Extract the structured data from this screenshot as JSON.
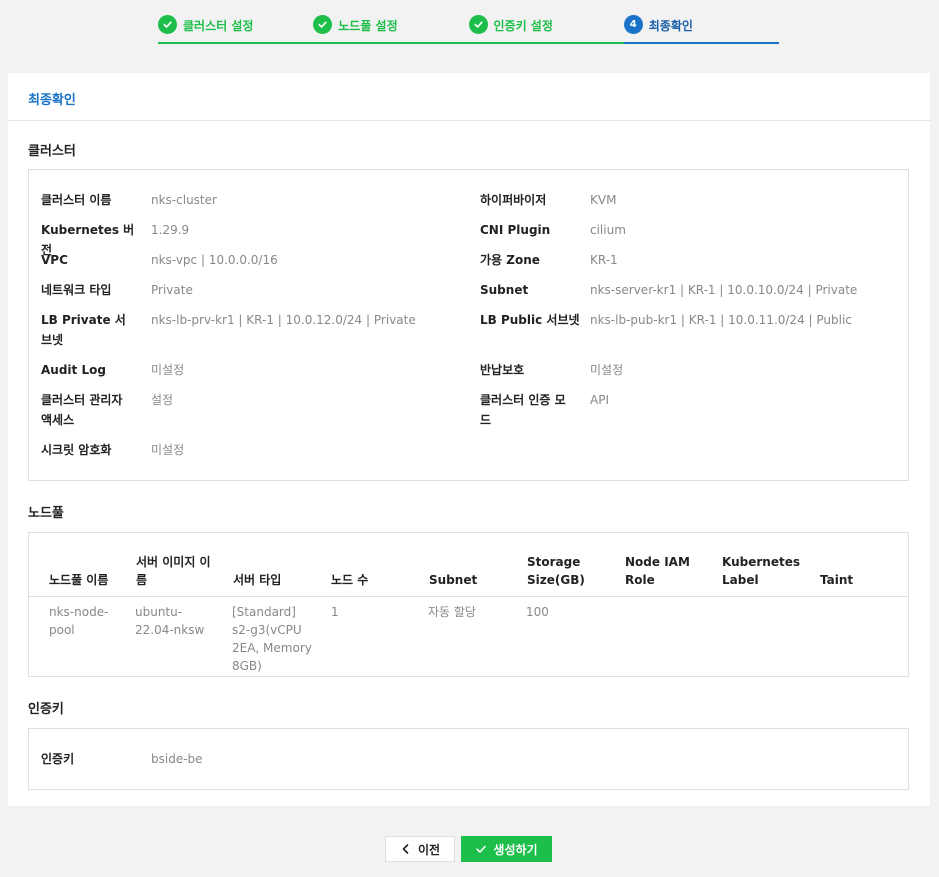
{
  "stepper": {
    "steps": [
      {
        "label": "클러스터 설정",
        "state": "done"
      },
      {
        "label": "노드풀 설정",
        "state": "done"
      },
      {
        "label": "인증키 설정",
        "state": "done"
      },
      {
        "label": "최종확인",
        "number": "4",
        "state": "active"
      }
    ]
  },
  "card": {
    "title": "최종확인"
  },
  "cluster": {
    "title": "클러스터",
    "left": [
      {
        "key": "클러스터 이름",
        "value": "nks-cluster"
      },
      {
        "key": "Kubernetes 버전",
        "value": "1.29.9"
      },
      {
        "key": "VPC",
        "value": "nks-vpc | 10.0.0.0/16"
      },
      {
        "key": "네트워크 타입",
        "value": "Private"
      },
      {
        "key": "LB Private 서브넷",
        "value": "nks-lb-prv-kr1 | KR-1 | 10.0.12.0/24 | Private"
      },
      {
        "key": "Audit Log",
        "value": "미설정"
      },
      {
        "key": "클러스터 관리자 액세스",
        "value": "설정"
      },
      {
        "key": "시크릿 암호화",
        "value": "미설정"
      }
    ],
    "right": [
      {
        "key": "하이퍼바이저",
        "value": "KVM"
      },
      {
        "key": "CNI Plugin",
        "value": "cilium"
      },
      {
        "key": "가용 Zone",
        "value": "KR-1"
      },
      {
        "key": "Subnet",
        "value": "nks-server-kr1 | KR-1 | 10.0.10.0/24 | Private"
      },
      {
        "key": "LB Public 서브넷",
        "value": "nks-lb-pub-kr1 | KR-1 | 10.0.11.0/24 | Public"
      },
      {
        "key": "반납보호",
        "value": "미설정"
      },
      {
        "key": "클러스터 인증 모드",
        "value": "API"
      }
    ]
  },
  "nodepool": {
    "title": "노드풀",
    "columns": [
      "노드풀 이름",
      "서버 이미지 이름",
      "서버 타입",
      "노드 수",
      "Subnet",
      "Storage Size(GB)",
      "Node IAM Role",
      "Kubernetes Label",
      "Taint"
    ],
    "rows": [
      [
        "nks-node-pool",
        "ubuntu-22.04-nksw",
        "[Standard] s2-g3(vCPU 2EA, Memory 8GB)",
        "1",
        "자동 할당",
        "100",
        "",
        "",
        ""
      ]
    ]
  },
  "authkey": {
    "title": "인증키",
    "key": "인증키",
    "value": "bside-be"
  },
  "buttons": {
    "prev": "이전",
    "create": "생성하기"
  },
  "colors": {
    "green": "#1dbf4a",
    "blue": "#1a73c8"
  }
}
